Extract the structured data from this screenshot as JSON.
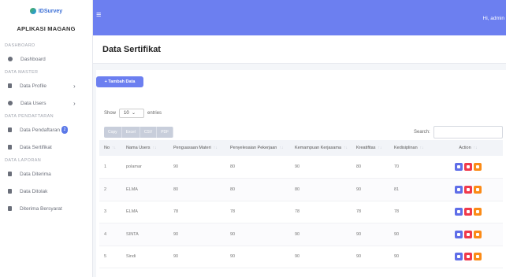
{
  "brand": {
    "logo_text": "IDSurvey",
    "app_name": "APLIKASI MAGANG"
  },
  "sidebar": {
    "sections": [
      {
        "title": "DASHBOARD",
        "items": [
          {
            "label": "Dashboard",
            "icon": "palette-icon"
          }
        ]
      },
      {
        "title": "DATA MASTER",
        "items": [
          {
            "label": "Data Profile",
            "icon": "file-icon",
            "has_chevron": true
          },
          {
            "label": "Data Users",
            "icon": "users-icon",
            "has_chevron": true
          }
        ]
      },
      {
        "title": "DATA PENDAFTARAN",
        "items": [
          {
            "label": "Data Pendaftaran",
            "icon": "file-icon",
            "badge": "2"
          },
          {
            "label": "Data Sertifikat",
            "icon": "file-icon"
          }
        ]
      },
      {
        "title": "DATA LAPORAN",
        "items": [
          {
            "label": "Data Diterima",
            "icon": "file-icon"
          },
          {
            "label": "Data Ditolak",
            "icon": "file-icon"
          },
          {
            "label": "Diterima Bersyarat",
            "icon": "file-icon"
          }
        ]
      }
    ],
    "chevron": "›"
  },
  "topbar": {
    "menu_icon": "≡",
    "greeting": "Hi, admin"
  },
  "page": {
    "title": "Data Sertifikat"
  },
  "toolbar": {
    "add_label": "+ Tambah Data",
    "show_label": "Show",
    "entries_value": "10",
    "entries_label": "entries",
    "export_buttons": [
      "Copy",
      "Excel",
      "CSV",
      "PDF"
    ],
    "search_label": "Search:"
  },
  "table": {
    "columns": [
      "No",
      "Nama Users",
      "Penguasaan Materi",
      "Penyelesaian Pekerjaan",
      "Kemampuan Kerjasama",
      "Kreatifitas",
      "Kedisiplinan",
      "Action"
    ],
    "rows": [
      [
        "1",
        "polamar",
        "90",
        "80",
        "90",
        "80",
        "70"
      ],
      [
        "2",
        "ELMA",
        "80",
        "80",
        "80",
        "90",
        "81"
      ],
      [
        "3",
        "ELMA",
        "78",
        "78",
        "78",
        "78",
        "78"
      ],
      [
        "4",
        "SINTA",
        "90",
        "90",
        "90",
        "90",
        "90"
      ],
      [
        "5",
        "Sindi",
        "90",
        "90",
        "90",
        "90",
        "90"
      ]
    ]
  },
  "colors": {
    "accent": "#6c7ff0",
    "edit": "#5f6ee8",
    "delete": "#f0394b",
    "print": "#fb8a16"
  }
}
